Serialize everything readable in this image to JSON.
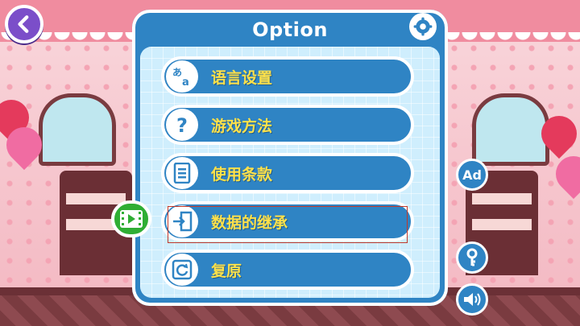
{
  "header": {
    "title": "Option"
  },
  "menu": [
    {
      "label": "语言设置",
      "icon": "language-icon"
    },
    {
      "label": "游戏方法",
      "icon": "help-icon"
    },
    {
      "label": "使用条款",
      "icon": "terms-icon"
    },
    {
      "label": "数据的继承",
      "icon": "data-transfer-icon"
    },
    {
      "label": "复原",
      "icon": "restore-icon"
    }
  ],
  "side": {
    "ad_label": "Ad"
  },
  "icons": [
    "back-arrow-icon",
    "gear-icon",
    "video-icon",
    "key-icon",
    "sound-icon",
    "language-icon",
    "help-icon",
    "terms-icon",
    "data-transfer-icon",
    "restore-icon"
  ],
  "colors": {
    "panel": "#2f84c4",
    "label_text": "#ffe14a",
    "back_button": "#7b4ec9",
    "video_button": "#2fae34",
    "selection": "#c0392b"
  }
}
